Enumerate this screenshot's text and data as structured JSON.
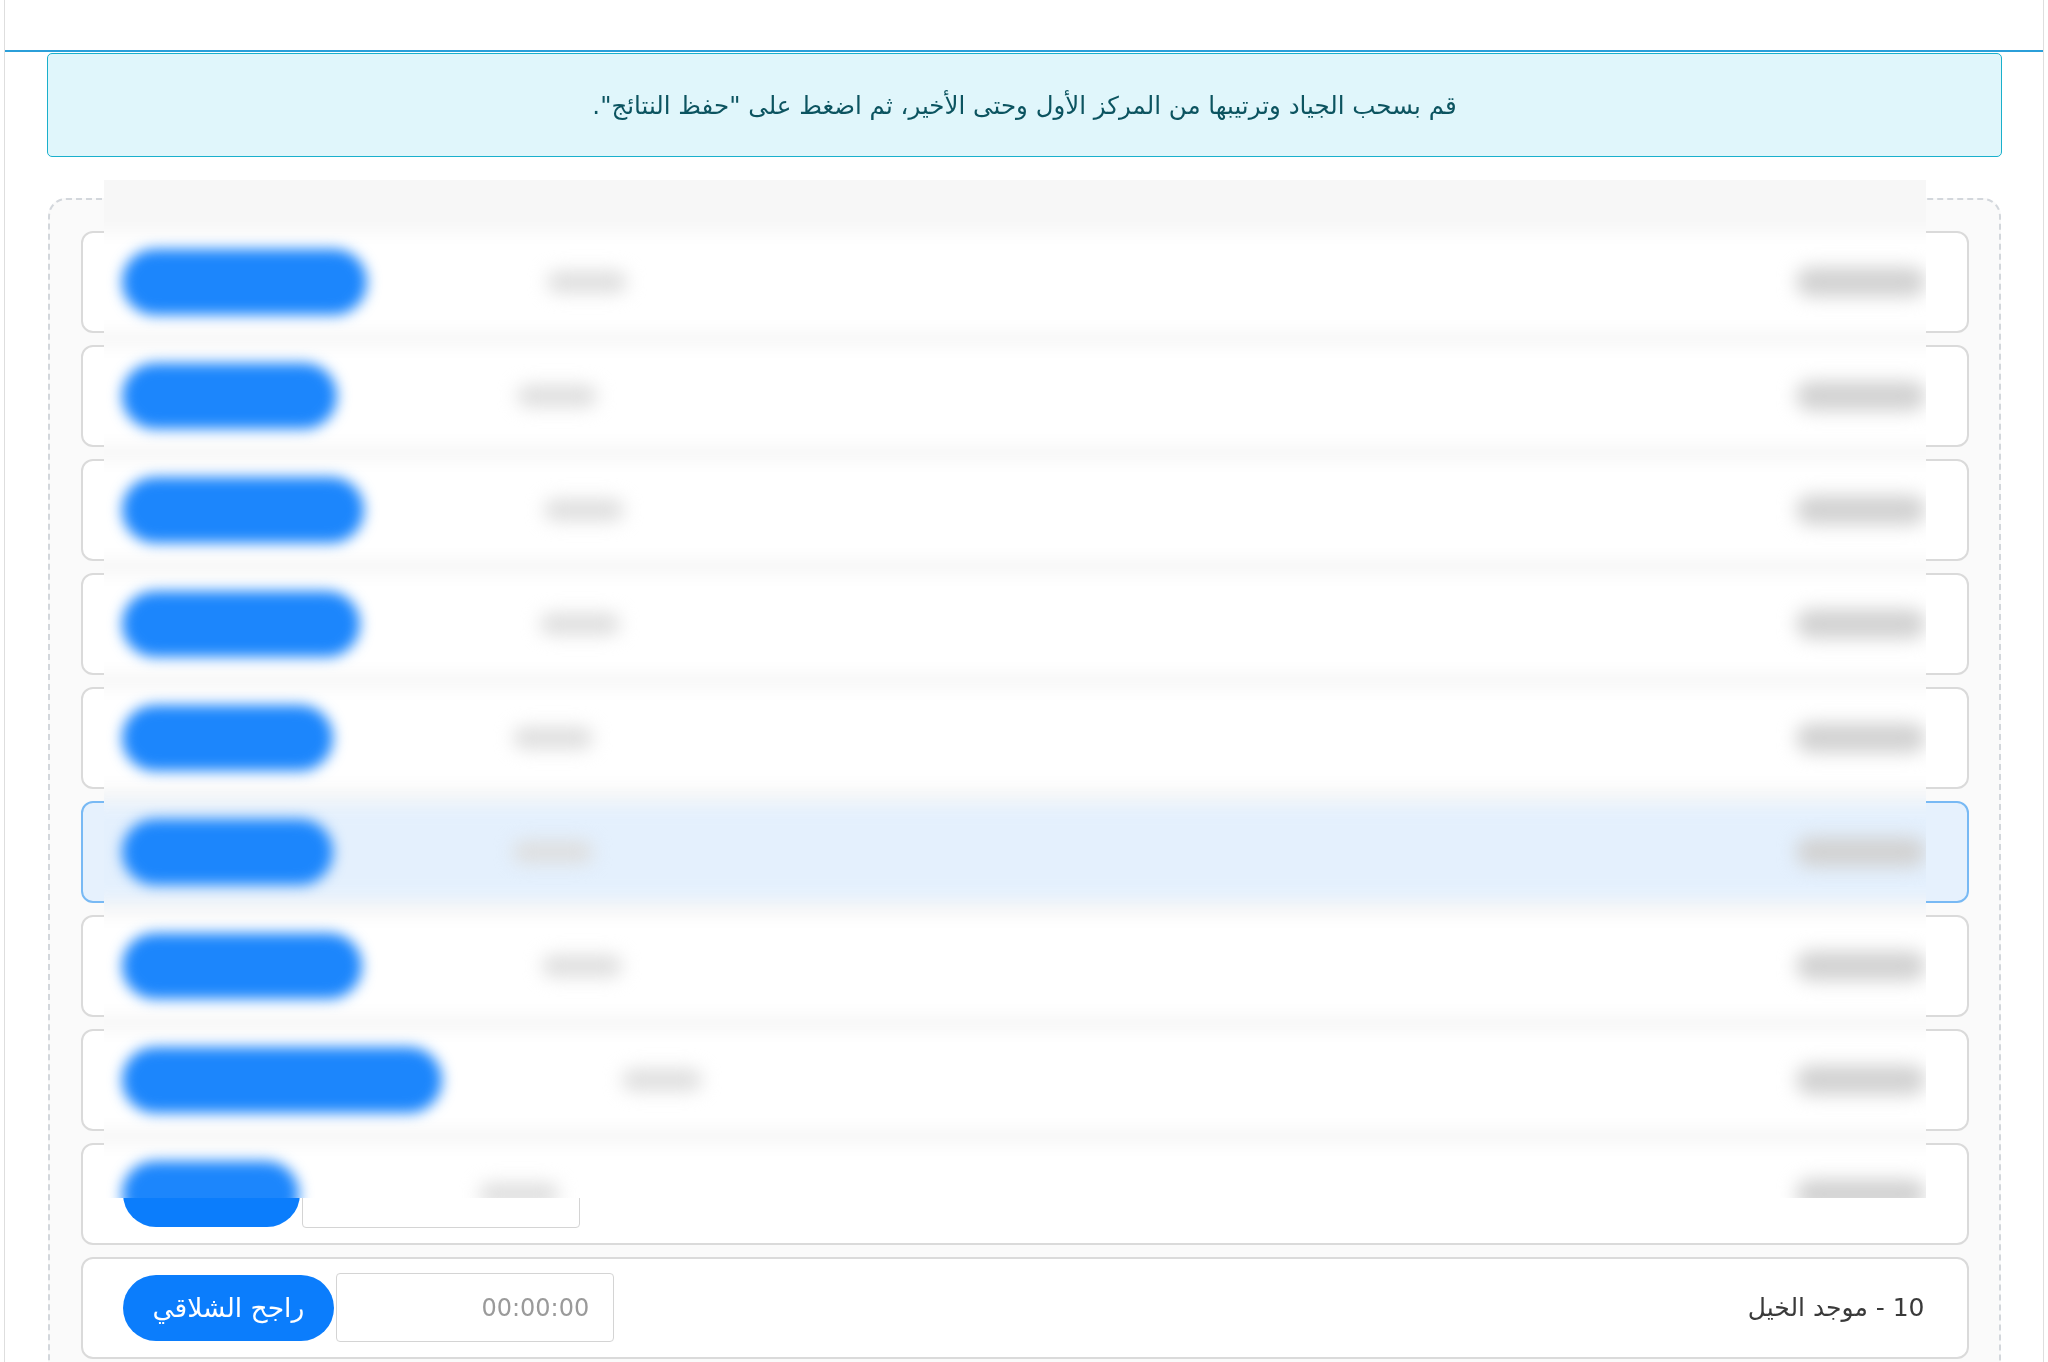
{
  "notice": "قم بسحب الجياد وترتيبها من المركز الأول وحتى الأخير، ثم اضغط على \"حفظ النتائج\".",
  "rows": [
    {
      "kind": "hidden",
      "selected": false
    },
    {
      "kind": "hidden",
      "selected": false
    },
    {
      "kind": "hidden",
      "selected": false
    },
    {
      "kind": "hidden",
      "selected": false
    },
    {
      "kind": "hidden",
      "selected": false
    },
    {
      "kind": "hidden",
      "selected": true
    },
    {
      "kind": "hidden",
      "selected": false
    },
    {
      "kind": "hidden",
      "selected": false
    },
    {
      "kind": "partial",
      "selected": false
    },
    {
      "kind": "visible",
      "selected": false,
      "title": "10 - موجد الخيل",
      "time_placeholder": "00:00:00",
      "button": "راجح الشلاقي"
    }
  ]
}
